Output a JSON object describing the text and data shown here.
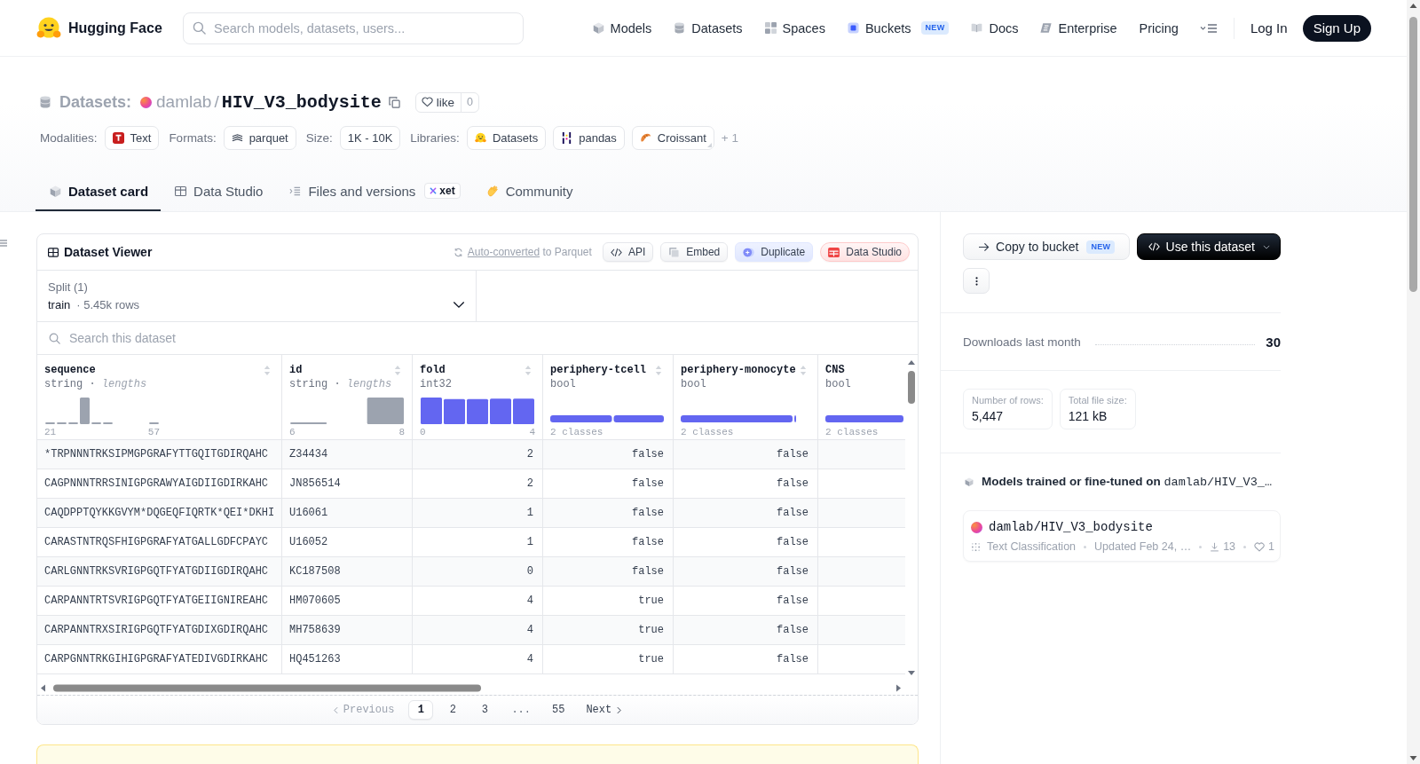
{
  "header": {
    "brand": "Hugging Face",
    "search": {
      "placeholder": "Search models, datasets, users..."
    },
    "nav": [
      {
        "label": "Models"
      },
      {
        "label": "Datasets"
      },
      {
        "label": "Spaces"
      },
      {
        "label": "Buckets",
        "badge": "NEW"
      },
      {
        "label": "Docs"
      },
      {
        "label": "Enterprise"
      },
      {
        "label": "Pricing"
      }
    ],
    "login": "Log In",
    "signup": "Sign Up"
  },
  "repo": {
    "type_label": "Datasets:",
    "owner": "damlab",
    "separator": "/",
    "name": "HIV_V3_bodysite",
    "like": {
      "label": "like",
      "count": "0"
    }
  },
  "tags": [
    {
      "label": "Modalities:",
      "chips": [
        "Text"
      ]
    },
    {
      "label": "Formats:",
      "chips": [
        "parquet"
      ]
    },
    {
      "label": "Size:",
      "chips": [
        "1K - 10K"
      ]
    },
    {
      "label": "Libraries:",
      "chips": [
        "Datasets",
        "pandas",
        "Croissant"
      ],
      "more": "+ 1"
    }
  ],
  "tabs": [
    {
      "label": "Dataset card",
      "selected": true
    },
    {
      "label": "Data Studio",
      "selected": false
    },
    {
      "label": "Files and versions",
      "selected": false,
      "badge": "xet"
    },
    {
      "label": "Community",
      "selected": false
    }
  ],
  "viewer": {
    "title": "Dataset Viewer",
    "conversion": {
      "link": "Auto-converted",
      "text": "to Parquet"
    },
    "actions": [
      {
        "label": "API"
      },
      {
        "label": "Embed"
      },
      {
        "label": "Duplicate"
      },
      {
        "label": "Data Studio"
      }
    ],
    "split": {
      "label": "Split (1)",
      "value": "train",
      "rows": "· 5.45k rows"
    },
    "search": {
      "placeholder": "Search this dataset"
    },
    "columns": [
      {
        "name": "sequence",
        "type": "string · *lengths*",
        "kind": "lengths",
        "min": "21",
        "max": "57"
      },
      {
        "name": "id",
        "type": "string · *lengths*",
        "kind": "lengths",
        "min": "6",
        "max": "8"
      },
      {
        "name": "fold",
        "type": "int32",
        "kind": "histogram",
        "min": "0",
        "max": "4"
      },
      {
        "name": "periphery-tcell",
        "type": "bool",
        "kind": "classes",
        "summary": "2 classes"
      },
      {
        "name": "periphery-monocyte",
        "type": "bool",
        "kind": "classes",
        "summary": "2 classes"
      },
      {
        "name": "CNS",
        "type": "bool",
        "kind": "classes",
        "summary": "2 classes"
      }
    ],
    "rows": [
      [
        "*TRPNNNTRKSIPMGPGRAFYTTGQITGDIRQAHC",
        "Z34434",
        "2",
        "false",
        "false"
      ],
      [
        "CAGPNNNTRRSINIGPGRAWYAIGDIIGDIRKAHC",
        "JN856514",
        "2",
        "false",
        "false"
      ],
      [
        "CAQDPPTQYKKGVYM*DQGEQFIQRTK*QEI*DKHI",
        "U16061",
        "1",
        "false",
        "false"
      ],
      [
        "CARASTNTRQSFHIGPGRAFYATGALLGDFCPAYC",
        "U16052",
        "1",
        "false",
        "false"
      ],
      [
        "CARLGNNTRKSVRIGPGQTFYATGDIIGDIRQAHC",
        "KC187508",
        "0",
        "false",
        "false"
      ],
      [
        "CARPANNTRTSVRIGPGQTFYATGEIIGNIREAHC",
        "HM070605",
        "4",
        "true",
        "false"
      ],
      [
        "CARPANNTRXSIRIGPGQTFYATGDIXGDIRQAHC",
        "MH758639",
        "4",
        "true",
        "false"
      ],
      [
        "CARPGNNTRKGIHIGPGRAFYATEDIVGDIRKAHC",
        "HQ451263",
        "4",
        "true",
        "false"
      ]
    ],
    "pagination": {
      "previous": {
        "label": "Previous",
        "disabled": true
      },
      "pages": [
        {
          "label": "1",
          "kind": "page",
          "selected": true
        },
        {
          "label": "2",
          "kind": "page",
          "selected": false
        },
        {
          "label": "3",
          "kind": "page",
          "selected": false
        },
        {
          "label": "...",
          "kind": "ellipsis",
          "selected": false
        },
        {
          "label": "55",
          "kind": "page",
          "selected": false
        }
      ],
      "next": {
        "label": "Next",
        "disabled": false
      }
    }
  },
  "sidebar": {
    "actions": [
      {
        "label": "Copy to bucket",
        "badge": "NEW",
        "kind": "outline"
      },
      {
        "label": "Use this dataset",
        "kind": "primary"
      }
    ],
    "downloads": {
      "label": "Downloads last month",
      "value": "30"
    },
    "stats": [
      {
        "label": "Number of rows:",
        "value": "5,447"
      },
      {
        "label": "Total file size:",
        "value": "121 kB"
      }
    ],
    "models": {
      "title": "Models trained or fine-tuned on",
      "repo": "damlab/HIV_V3_…",
      "items": [
        {
          "name": "damlab/HIV_V3_bodysite",
          "task": "Text Classification",
          "updated": "Updated Feb 24, …",
          "downloads": "13",
          "likes": "1"
        }
      ]
    }
  }
}
